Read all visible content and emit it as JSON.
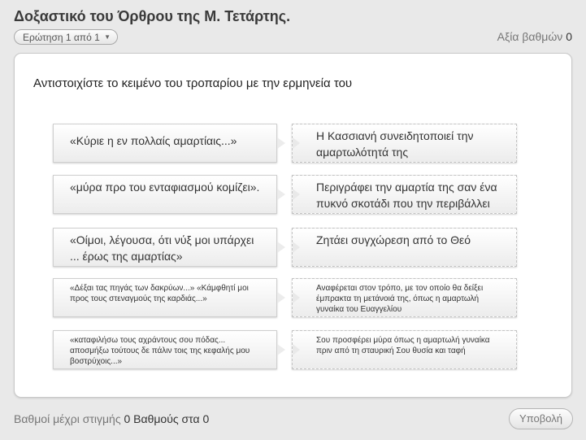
{
  "header": {
    "title": "Δοξαστικό του Όρθρου της Μ. Τετάρτης.",
    "question_selector": "Ερώτηση 1 από 1",
    "points_label": "Αξία βαθμών",
    "points_value": "0"
  },
  "question": {
    "instruction": "Αντιστοιχίστε το κειμένο του τροπαρίου με την ερμηνεία του",
    "pairs": [
      {
        "left": "«Κύριε η εν πολλαίς αμαρτίαις...»",
        "right": "Η Κασσιανή συνειδητοποιεί την αμαρτωλότητά της"
      },
      {
        "left": "«μύρα προ του ενταφιασμού κομίζει».",
        "right": "Περιγράφει την αμαρτία της σαν ένα πυκνό σκοτάδι που την περιβάλλει"
      },
      {
        "left": "«Οίμοι, λέγουσα, ότι νύξ μοι υπάρχει ... έρως της αμαρτίας»",
        "right": "Ζητάει συγχώρεση από το Θεό"
      },
      {
        "left": "«Δέξαι τας πηγάς των δακρύων...» «Κάμφθητί μοι προς τους στεναγμούς της καρδιάς...»",
        "right": "Αναφέρεται στον τρόπο, με τον οποίο θα δείξει έμπρακτα τη μετάνοιά της, όπως η αμαρτωλή γυναίκα του Ευαγγελίου"
      },
      {
        "left": "«καταφιλήσω τους αχράντους σου πόδας... αποσμήξω τούτους δε πάλιν τοις της κεφαλής μου βοστρύχοις...»",
        "right": "Σου προσφέρει μύρα όπως η αμαρτωλή γυναίκα πριν από τη σταυρική Σου θυσία και ταφή"
      }
    ]
  },
  "footer": {
    "score_label": "Βαθμοί μέχρι στιγμής",
    "score_value": "0 Βαθμούς στα 0",
    "submit_label": "Υποβολή"
  },
  "icons": {
    "selector_chevron": "chevron-down-icon"
  },
  "colors": {
    "background": "#e9e9e9",
    "card": "#ffffff",
    "text": "#333333",
    "muted": "#777777"
  }
}
